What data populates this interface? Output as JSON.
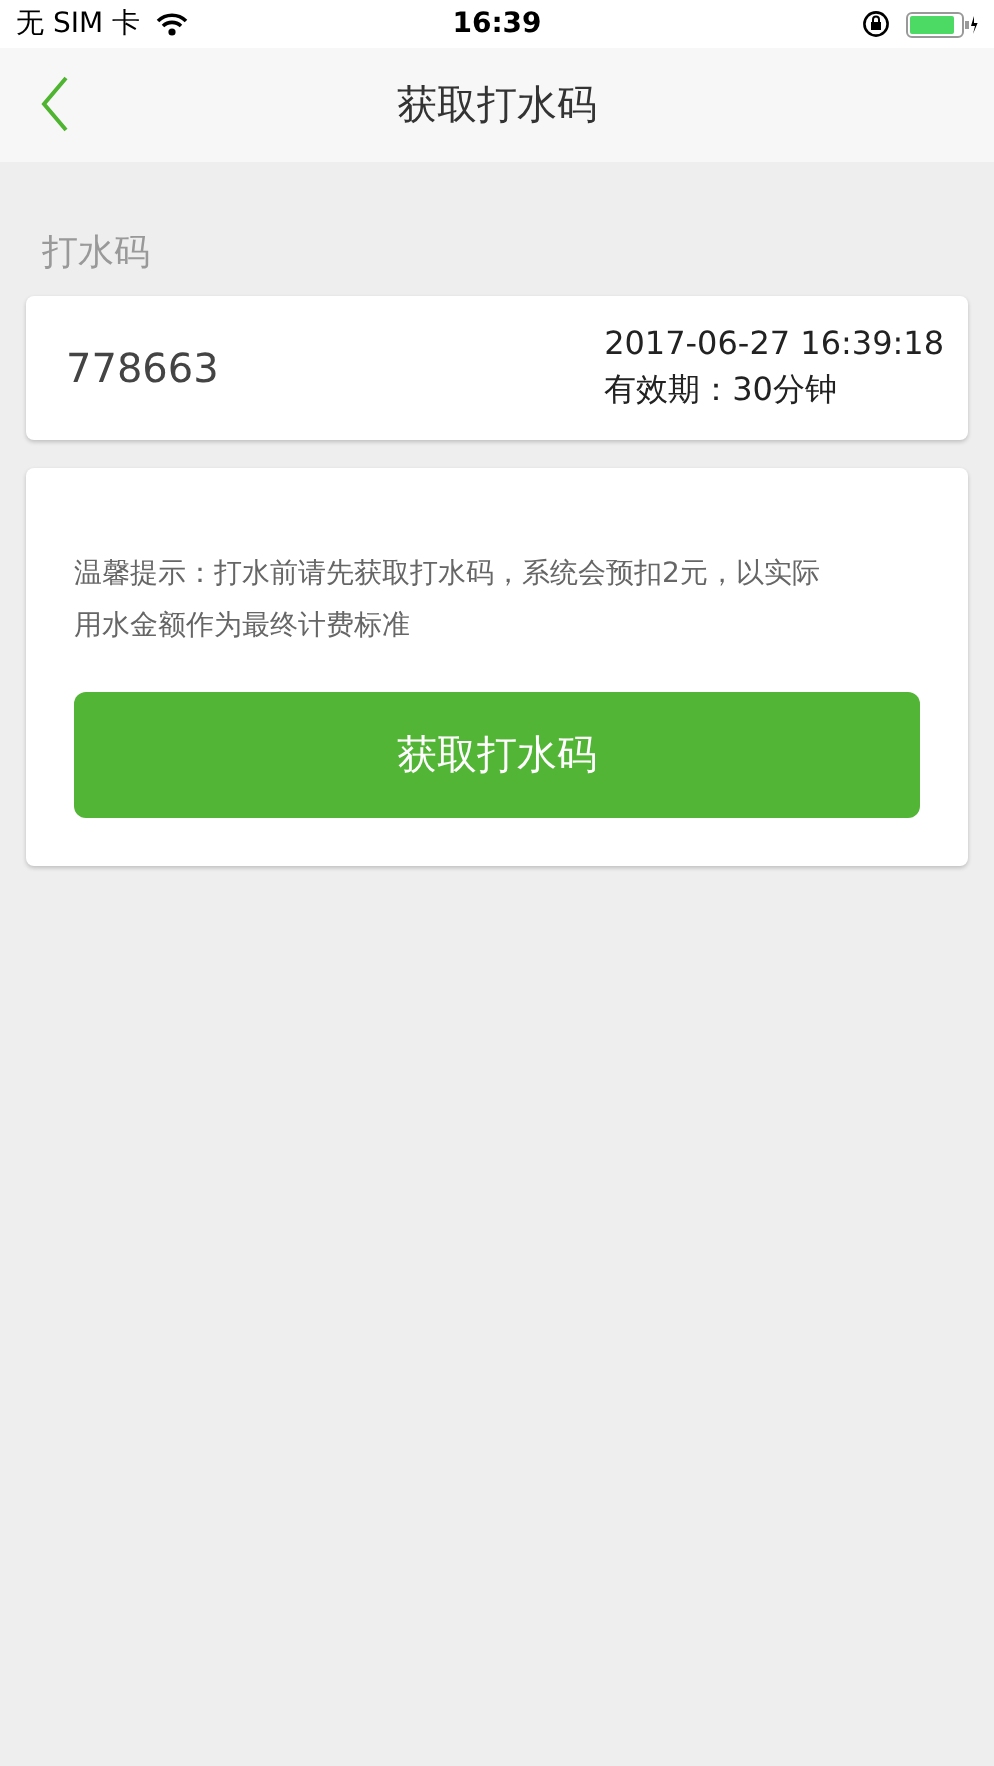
{
  "status_bar": {
    "carrier": "无 SIM 卡",
    "time": "16:39"
  },
  "nav": {
    "title": "获取打水码"
  },
  "section_label": "打水码",
  "code_card": {
    "code": "778663",
    "timestamp": "2017-06-27 16:39:18",
    "validity": "有效期：30分钟"
  },
  "tip_card": {
    "tip": "温馨提示：打水前请先获取打水码，系统会预扣2元，以实际用水金额作为最终计费标准",
    "button": "获取打水码"
  }
}
